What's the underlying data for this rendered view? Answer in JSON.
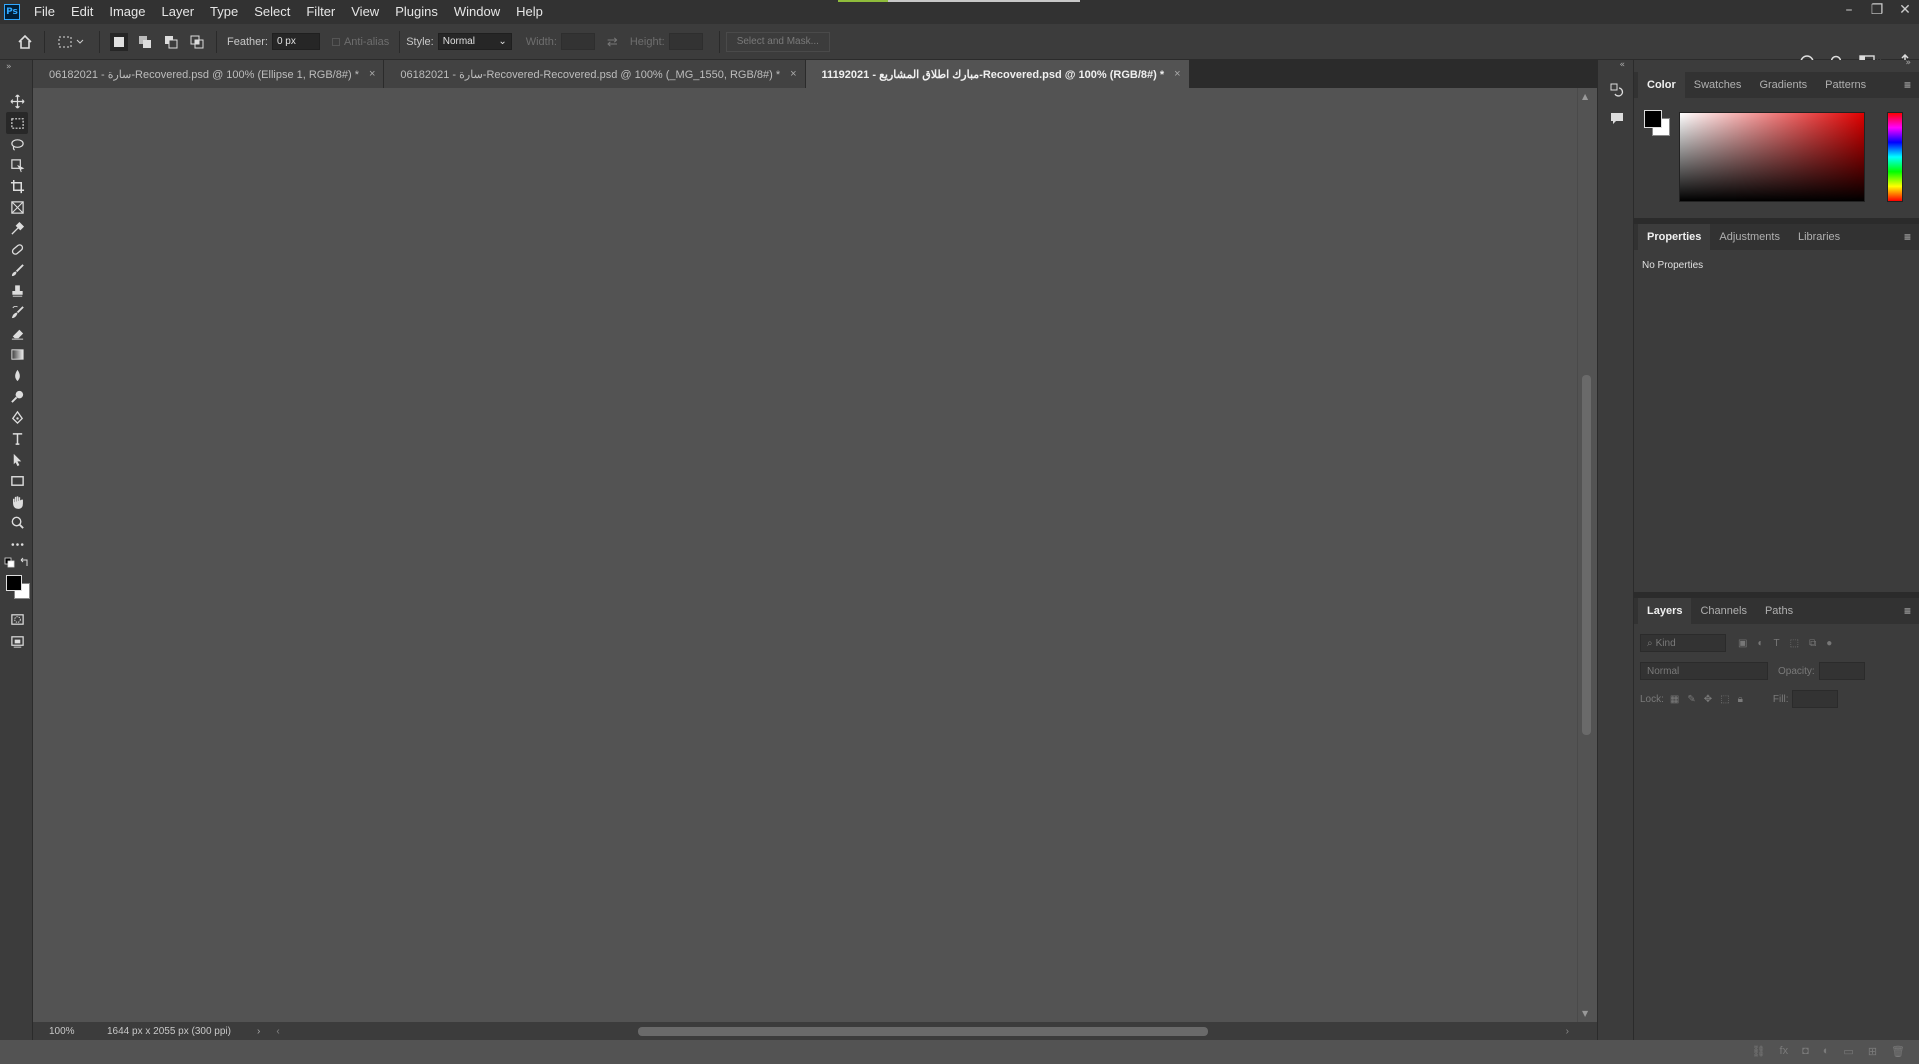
{
  "app": {
    "logo": "Ps"
  },
  "menu": [
    "File",
    "Edit",
    "Image",
    "Layer",
    "Type",
    "Select",
    "Filter",
    "View",
    "Plugins",
    "Window",
    "Help"
  ],
  "window_controls": {
    "minimize": "–",
    "restore": "❐",
    "close": "✕"
  },
  "options_bar": {
    "feather_label": "Feather:",
    "feather_value": "0 px",
    "anti_alias_label": "Anti-alias",
    "style_label": "Style:",
    "style_value": "Normal",
    "width_label": "Width:",
    "height_label": "Height:",
    "select_mask_label": "Select and Mask..."
  },
  "tabs": [
    {
      "label": "06182021 - سارة-Recovered.psd @ 100% (Ellipse 1, RGB/8#) *",
      "close": "×"
    },
    {
      "label": "06182021 - سارة-Recovered-Recovered.psd @ 100% (_MG_1550, RGB/8#) *",
      "close": "×"
    },
    {
      "label": "11192021 - مبارك اطلاق المشاريع-Recovered.psd @ 100% (RGB/8#) *",
      "close": "×"
    }
  ],
  "status": {
    "zoom": "100%",
    "doc_info": "1644 px x 2055 px (300 ppi)"
  },
  "color_panel": {
    "tabs": [
      "Color",
      "Swatches",
      "Gradients",
      "Patterns"
    ],
    "fg_color": "#000000",
    "bg_color": "#ffffff",
    "hue_color": "#e00000"
  },
  "properties_panel": {
    "tabs": [
      "Properties",
      "Adjustments",
      "Libraries"
    ],
    "empty_text": "No Properties"
  },
  "layers_panel": {
    "tabs": [
      "Layers",
      "Channels",
      "Paths"
    ],
    "kind_placeholder": "Kind",
    "blend_mode": "Normal",
    "opacity_label": "Opacity:",
    "lock_label": "Lock:",
    "fill_label": "Fill:"
  }
}
